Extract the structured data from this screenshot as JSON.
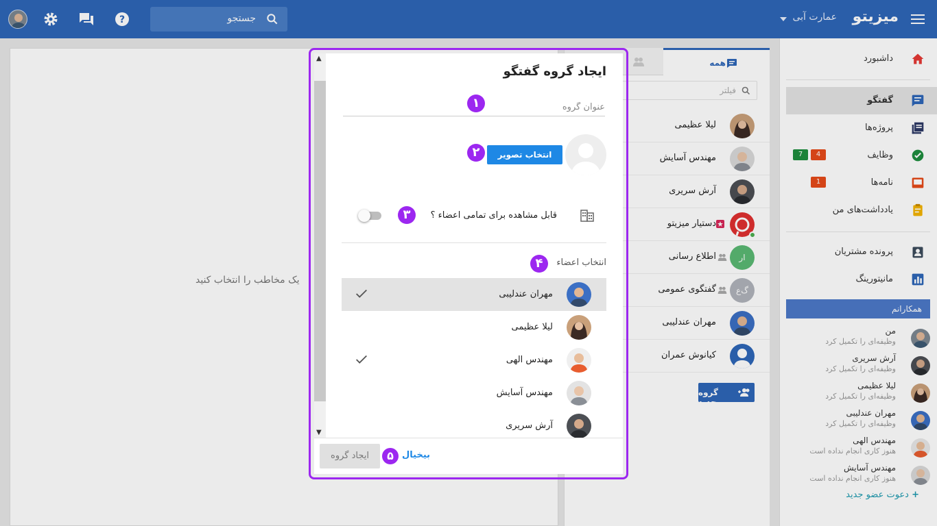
{
  "topbar": {
    "brand": "میزیتو",
    "company": "عمارت آبی",
    "search_placeholder": "جستجو"
  },
  "sidebar": {
    "items": [
      {
        "label": "داشبورد",
        "icon": "home-icon"
      },
      {
        "label": "گفتگو",
        "icon": "chat-icon"
      },
      {
        "label": "پروژه‌ها",
        "icon": "projects-icon"
      },
      {
        "label": "وظایف",
        "icon": "tasks-icon",
        "badges": [
          "7",
          "4"
        ]
      },
      {
        "label": "نامه‌ها",
        "icon": "mail-icon",
        "badges": [
          "1"
        ]
      },
      {
        "label": "یادداشت‌های من",
        "icon": "notes-icon"
      },
      {
        "label": "پرونده مشتریان",
        "icon": "contacts-icon"
      },
      {
        "label": "مانیتورینگ",
        "icon": "monitoring-icon"
      }
    ],
    "colleagues_title": "همکارانم",
    "colleagues": [
      {
        "name": "من",
        "status": "وظیفه‌ای را تکمیل کرد"
      },
      {
        "name": "آرش سریری",
        "status": "وظیفه‌ای را تکمیل کرد"
      },
      {
        "name": "لیلا عظیمی",
        "status": "وظیفه‌ای را تکمیل کرد"
      },
      {
        "name": "مهران عندلیبی",
        "status": "وظیفه‌ای را تکمیل کرد"
      },
      {
        "name": "مهندس الهی",
        "status": "هنوز کاری انجام نداده است"
      },
      {
        "name": "مهندس آسایش",
        "status": "هنوز کاری انجام نداده است"
      }
    ],
    "invite": "دعوت عضو جدید"
  },
  "chatlist": {
    "tab_all": "همه",
    "filter_placeholder": "فیلتر",
    "items": [
      {
        "name": "لیلا عظیمی"
      },
      {
        "name": "مهندس آسایش"
      },
      {
        "name": "آرش سریری"
      },
      {
        "name": "دستیار میزیتو"
      },
      {
        "name": "اطلاع رسانی",
        "initials": "ار"
      },
      {
        "name": "گفتگوی عمومی",
        "initials": "گ‌ع"
      },
      {
        "name": "مهران عندلیبی"
      },
      {
        "name": "کیانوش عمران"
      }
    ],
    "new_group": "گروه جدید"
  },
  "main": {
    "empty_message": "یک مخاطب را انتخاب کنید"
  },
  "dialog": {
    "title": "ایجاد گروه گفتگو",
    "group_title_placeholder": "عنوان گروه",
    "pick_icon": "انتخاب تصویر نشانه",
    "visibility_label": "قابل مشاهده برای تمامی اعضاء ؟",
    "visibility_on": false,
    "members_label": "انتخاب اعضاء",
    "members": [
      {
        "name": "مهران عندلیبی",
        "checked": true,
        "highlighted": true
      },
      {
        "name": "لیلا عظیمی",
        "checked": false
      },
      {
        "name": "مهندس الهی",
        "checked": true
      },
      {
        "name": "مهندس آسایش",
        "checked": false
      },
      {
        "name": "آرش سریری",
        "checked": false
      }
    ],
    "create_button": "ایجاد گروه",
    "cancel_button": "بیخیال",
    "steps": [
      "۱",
      "۲",
      "۳",
      "۴",
      "۵"
    ]
  },
  "colors": {
    "primary": "#2e66b8",
    "accent_purple": "#9c27f0",
    "link_blue": "#1e88e5"
  }
}
